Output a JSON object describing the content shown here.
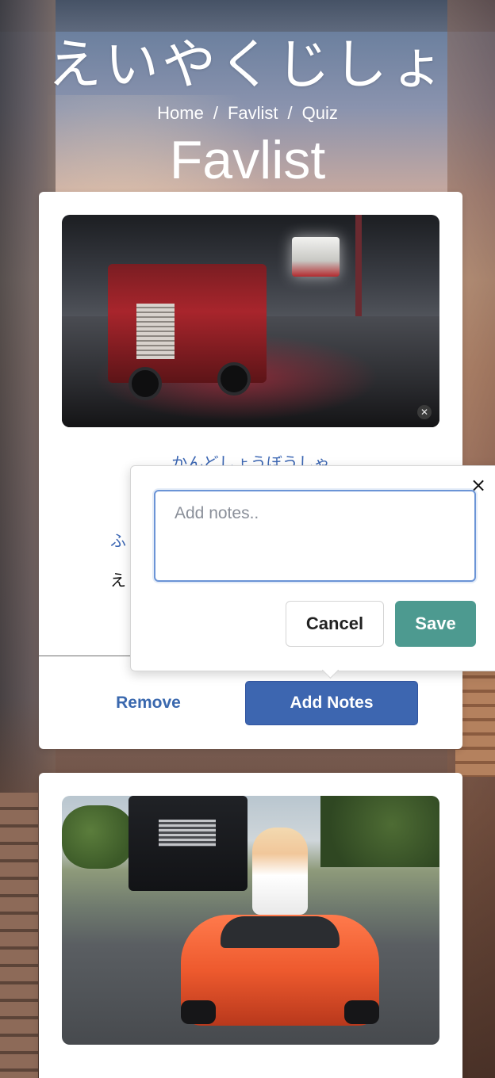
{
  "header": {
    "site_title": "えいやくじしょ",
    "breadcrumb": [
      {
        "label": "Home"
      },
      {
        "label": "Favlist"
      },
      {
        "label": "Quiz"
      }
    ],
    "breadcrumb_separator": "/",
    "page_heading": "Favlist"
  },
  "cards": [
    {
      "image_alt": "fire truck gif",
      "image_badge_icon": "gif-play-icon",
      "reading": "かんどしょうぼうしゃ",
      "meta_line_1": "ふ",
      "meta_line_2": "え",
      "remove_label": "Remove",
      "add_notes_label": "Add Notes"
    },
    {
      "image_alt": "child in toy car gif"
    }
  ],
  "notes_popover": {
    "placeholder": "Add notes..",
    "value": "",
    "cancel_label": "Cancel",
    "save_label": "Save",
    "close_glyph": "×"
  },
  "colors": {
    "link_blue": "#3b66b3",
    "primary_button": "#3d66b0",
    "save_button": "#4d9a90",
    "textarea_focus": "#6b94d6"
  }
}
